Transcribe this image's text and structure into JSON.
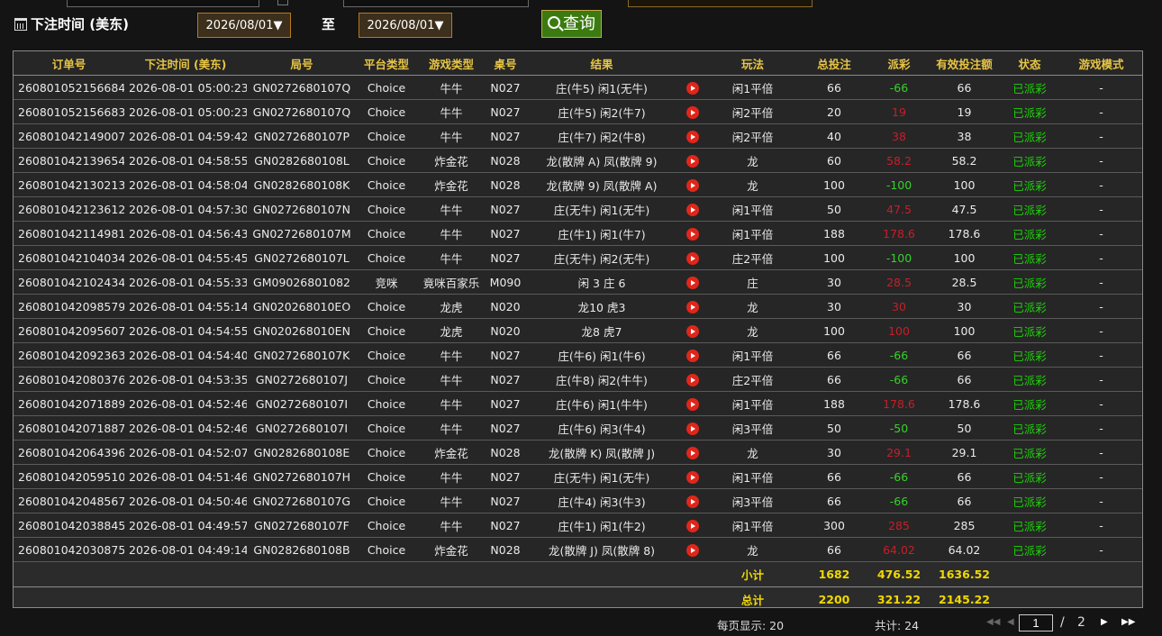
{
  "filter": {
    "label": "下注时间 (美东)",
    "start_date": "2026/08/01▼",
    "to_label": "至",
    "end_date": "2026/08/01▼",
    "query_label": "查询"
  },
  "table": {
    "columns": [
      "订单号",
      "下注时间 (美东)",
      "局号",
      "平台类型",
      "游戏类型",
      "桌号",
      "结果",
      "",
      "玩法",
      "总投注",
      "派彩",
      "有效投注额",
      "状态",
      "游戏模式"
    ],
    "rows": [
      {
        "order": "260801052156684",
        "time": "2026-08-01 05:00:23",
        "round": "GN0272680107Q",
        "platform": "Choice",
        "game": "牛牛",
        "table": "N027",
        "result": "庄(牛5) 闲1(无牛)",
        "play": "闲1平倍",
        "bet": "66",
        "payout": "-66",
        "payout_color": "green",
        "valid": "66",
        "status": "已派彩",
        "mode": "-"
      },
      {
        "order": "260801052156683",
        "time": "2026-08-01 05:00:23",
        "round": "GN0272680107Q",
        "platform": "Choice",
        "game": "牛牛",
        "table": "N027",
        "result": "庄(牛5) 闲2(牛7)",
        "play": "闲2平倍",
        "bet": "20",
        "payout": "19",
        "payout_color": "red",
        "valid": "19",
        "status": "已派彩",
        "mode": "-"
      },
      {
        "order": "260801042149007",
        "time": "2026-08-01 04:59:42",
        "round": "GN0272680107P",
        "platform": "Choice",
        "game": "牛牛",
        "table": "N027",
        "result": "庄(牛7) 闲2(牛8)",
        "play": "闲2平倍",
        "bet": "40",
        "payout": "38",
        "payout_color": "red",
        "valid": "38",
        "status": "已派彩",
        "mode": "-"
      },
      {
        "order": "260801042139654",
        "time": "2026-08-01 04:58:55",
        "round": "GN0282680108L",
        "platform": "Choice",
        "game": "炸金花",
        "table": "N028",
        "result": "龙(散牌 A) 凤(散牌 9)",
        "play": "龙",
        "bet": "60",
        "payout": "58.2",
        "payout_color": "red",
        "valid": "58.2",
        "status": "已派彩",
        "mode": "-"
      },
      {
        "order": "260801042130213",
        "time": "2026-08-01 04:58:04",
        "round": "GN0282680108K",
        "platform": "Choice",
        "game": "炸金花",
        "table": "N028",
        "result": "龙(散牌 9) 凤(散牌 A)",
        "play": "龙",
        "bet": "100",
        "payout": "-100",
        "payout_color": "green",
        "valid": "100",
        "status": "已派彩",
        "mode": "-"
      },
      {
        "order": "260801042123612",
        "time": "2026-08-01 04:57:30",
        "round": "GN0272680107N",
        "platform": "Choice",
        "game": "牛牛",
        "table": "N027",
        "result": "庄(无牛) 闲1(无牛)",
        "play": "闲1平倍",
        "bet": "50",
        "payout": "47.5",
        "payout_color": "red",
        "valid": "47.5",
        "status": "已派彩",
        "mode": "-"
      },
      {
        "order": "260801042114981",
        "time": "2026-08-01 04:56:43",
        "round": "GN0272680107M",
        "platform": "Choice",
        "game": "牛牛",
        "table": "N027",
        "result": "庄(牛1) 闲1(牛7)",
        "play": "闲1平倍",
        "bet": "188",
        "payout": "178.6",
        "payout_color": "red",
        "valid": "178.6",
        "status": "已派彩",
        "mode": "-"
      },
      {
        "order": "260801042104034",
        "time": "2026-08-01 04:55:45",
        "round": "GN0272680107L",
        "platform": "Choice",
        "game": "牛牛",
        "table": "N027",
        "result": "庄(无牛) 闲2(无牛)",
        "play": "庄2平倍",
        "bet": "100",
        "payout": "-100",
        "payout_color": "green",
        "valid": "100",
        "status": "已派彩",
        "mode": "-"
      },
      {
        "order": "260801042102434",
        "time": "2026-08-01 04:55:33",
        "round": "GM09026801082",
        "platform": "竞咪",
        "game": "竟咪百家乐",
        "table": "M090",
        "result": "闲 3 庄 6",
        "play": "庄",
        "bet": "30",
        "payout": "28.5",
        "payout_color": "red",
        "valid": "28.5",
        "status": "已派彩",
        "mode": "-"
      },
      {
        "order": "260801042098579",
        "time": "2026-08-01 04:55:14",
        "round": "GN020268010EO",
        "platform": "Choice",
        "game": "龙虎",
        "table": "N020",
        "result": "龙10 虎3",
        "play": "龙",
        "bet": "30",
        "payout": "30",
        "payout_color": "red",
        "valid": "30",
        "status": "已派彩",
        "mode": "-"
      },
      {
        "order": "260801042095607",
        "time": "2026-08-01 04:54:55",
        "round": "GN020268010EN",
        "platform": "Choice",
        "game": "龙虎",
        "table": "N020",
        "result": "龙8 虎7",
        "play": "龙",
        "bet": "100",
        "payout": "100",
        "payout_color": "red",
        "valid": "100",
        "status": "已派彩",
        "mode": "-"
      },
      {
        "order": "260801042092363",
        "time": "2026-08-01 04:54:40",
        "round": "GN0272680107K",
        "platform": "Choice",
        "game": "牛牛",
        "table": "N027",
        "result": "庄(牛6) 闲1(牛6)",
        "play": "闲1平倍",
        "bet": "66",
        "payout": "-66",
        "payout_color": "green",
        "valid": "66",
        "status": "已派彩",
        "mode": "-"
      },
      {
        "order": "260801042080376",
        "time": "2026-08-01 04:53:35",
        "round": "GN0272680107J",
        "platform": "Choice",
        "game": "牛牛",
        "table": "N027",
        "result": "庄(牛8) 闲2(牛牛)",
        "play": "庄2平倍",
        "bet": "66",
        "payout": "-66",
        "payout_color": "green",
        "valid": "66",
        "status": "已派彩",
        "mode": "-"
      },
      {
        "order": "260801042071889",
        "time": "2026-08-01 04:52:46",
        "round": "GN0272680107I",
        "platform": "Choice",
        "game": "牛牛",
        "table": "N027",
        "result": "庄(牛6) 闲1(牛牛)",
        "play": "闲1平倍",
        "bet": "188",
        "payout": "178.6",
        "payout_color": "red",
        "valid": "178.6",
        "status": "已派彩",
        "mode": "-"
      },
      {
        "order": "260801042071887",
        "time": "2026-08-01 04:52:46",
        "round": "GN0272680107I",
        "platform": "Choice",
        "game": "牛牛",
        "table": "N027",
        "result": "庄(牛6) 闲3(牛4)",
        "play": "闲3平倍",
        "bet": "50",
        "payout": "-50",
        "payout_color": "green",
        "valid": "50",
        "status": "已派彩",
        "mode": "-"
      },
      {
        "order": "260801042064396",
        "time": "2026-08-01 04:52:07",
        "round": "GN0282680108E",
        "platform": "Choice",
        "game": "炸金花",
        "table": "N028",
        "result": "龙(散牌 K) 凤(散牌 J)",
        "play": "龙",
        "bet": "30",
        "payout": "29.1",
        "payout_color": "red",
        "valid": "29.1",
        "status": "已派彩",
        "mode": "-"
      },
      {
        "order": "260801042059510",
        "time": "2026-08-01 04:51:46",
        "round": "GN0272680107H",
        "platform": "Choice",
        "game": "牛牛",
        "table": "N027",
        "result": "庄(无牛) 闲1(无牛)",
        "play": "闲1平倍",
        "bet": "66",
        "payout": "-66",
        "payout_color": "green",
        "valid": "66",
        "status": "已派彩",
        "mode": "-"
      },
      {
        "order": "260801042048567",
        "time": "2026-08-01 04:50:46",
        "round": "GN0272680107G",
        "platform": "Choice",
        "game": "牛牛",
        "table": "N027",
        "result": "庄(牛4) 闲3(牛3)",
        "play": "闲3平倍",
        "bet": "66",
        "payout": "-66",
        "payout_color": "green",
        "valid": "66",
        "status": "已派彩",
        "mode": "-"
      },
      {
        "order": "260801042038845",
        "time": "2026-08-01 04:49:57",
        "round": "GN0272680107F",
        "platform": "Choice",
        "game": "牛牛",
        "table": "N027",
        "result": "庄(牛1) 闲1(牛2)",
        "play": "闲1平倍",
        "bet": "300",
        "payout": "285",
        "payout_color": "red",
        "valid": "285",
        "status": "已派彩",
        "mode": "-"
      },
      {
        "order": "260801042030875",
        "time": "2026-08-01 04:49:14",
        "round": "GN0282680108B",
        "platform": "Choice",
        "game": "炸金花",
        "table": "N028",
        "result": "龙(散牌 J) 凤(散牌 8)",
        "play": "龙",
        "bet": "66",
        "payout": "64.02",
        "payout_color": "red",
        "valid": "64.02",
        "status": "已派彩",
        "mode": "-"
      }
    ],
    "subtotal": {
      "label": "小计",
      "bet": "1682",
      "payout": "476.52",
      "valid": "1636.52"
    },
    "total": {
      "label": "总计",
      "bet": "2200",
      "payout": "321.22",
      "valid": "2145.22"
    }
  },
  "pagination": {
    "page_size": "每页显示: 20",
    "total": "共计: 24",
    "first": "◀◀",
    "prev": "◀",
    "current": "1",
    "slash": "/",
    "pages": "2",
    "next": "▶",
    "last": "▶▶"
  },
  "colors": {
    "payout_green": "#35d22a",
    "payout_red": "#c81e28",
    "status_green": "#1ed20a",
    "header_gold": "#e8c545",
    "sum_yellow": "#f0d800"
  }
}
